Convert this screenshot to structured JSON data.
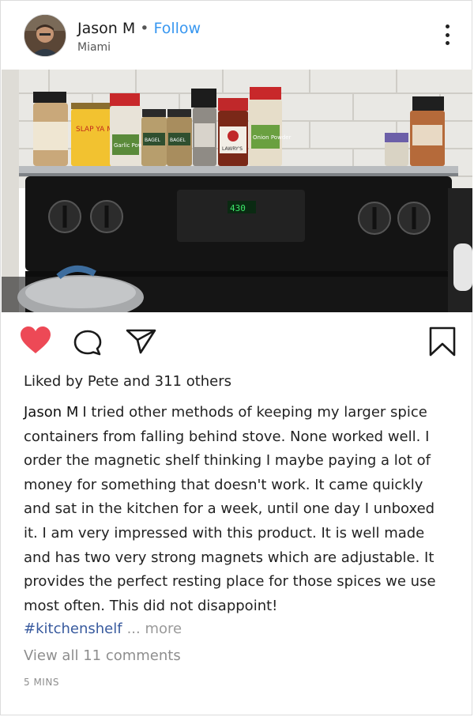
{
  "post": {
    "user_name": "Jason M",
    "separator": "•",
    "follow_label": "Follow",
    "location": "Miami",
    "likes": {
      "prefix": "Liked by",
      "liker": "Pete",
      "conjunction": "and",
      "others": "311 others"
    },
    "caption_author": "Jason M",
    "caption_text": "I tried other methods of keeping my larger spice containers from falling behind stove. None worked well. I order the magnetic shelf thinking I maybe paying a lot of money for something that doesn't work. It came quickly and sat in the kitchen for a week, until one day I unboxed it. I am very impressed with this product. It is well made and has two very strong magnets which are adjustable. It provides the perfect resting place for those spices we use most often. This did not disappoint!",
    "hashtag": "#kitchenshelf",
    "more_label": "... more",
    "view_comments": "View all 11 comments",
    "timestamp": "5 MINS"
  },
  "photo": {
    "oven_display": "430",
    "spice_labels": {
      "slap_ya_mama": "SLAP YA MAMA",
      "garlic": "Garlic Powder",
      "bagel_1": "BAGEL",
      "bagel_2": "BAGEL",
      "onion": "Onion Powder",
      "brand": "LAWRY'S"
    }
  },
  "icons": {
    "like": "heart-icon",
    "comment": "comment-icon",
    "share": "send-icon",
    "save": "bookmark-icon",
    "more": "more-vertical-icon"
  },
  "colors": {
    "like": "#ed4956",
    "follow": "#3897f0",
    "hashtag": "#385a9e",
    "muted": "#8e8e8e"
  }
}
